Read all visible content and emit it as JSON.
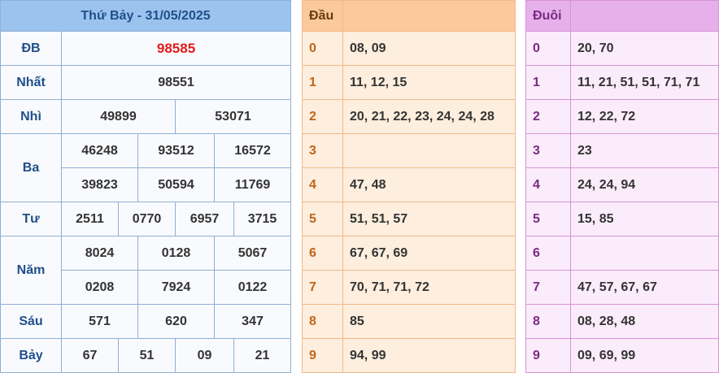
{
  "results": {
    "title": "Thứ Bảy - 31/05/2025",
    "prizes": [
      {
        "label": "ĐB",
        "values": [
          "98585"
        ]
      },
      {
        "label": "Nhất",
        "values": [
          "98551"
        ]
      },
      {
        "label": "Nhì",
        "values": [
          "49899",
          "53071"
        ]
      },
      {
        "label": "Ba",
        "values": [
          "46248",
          "93512",
          "16572",
          "39823",
          "50594",
          "11769"
        ]
      },
      {
        "label": "Tư",
        "values": [
          "2511",
          "0770",
          "6957",
          "3715"
        ]
      },
      {
        "label": "Năm",
        "values": [
          "8024",
          "0128",
          "5067",
          "0208",
          "7924",
          "0122"
        ]
      },
      {
        "label": "Sáu",
        "values": [
          "571",
          "620",
          "347"
        ]
      },
      {
        "label": "Bảy",
        "values": [
          "67",
          "51",
          "09",
          "21"
        ]
      }
    ]
  },
  "dau": {
    "header": "Đầu",
    "rows": [
      {
        "key": "0",
        "value": "08, 09"
      },
      {
        "key": "1",
        "value": "11, 12, 15"
      },
      {
        "key": "2",
        "value": "20, 21, 22, 23, 24, 24, 28"
      },
      {
        "key": "3",
        "value": ""
      },
      {
        "key": "4",
        "value": "47, 48"
      },
      {
        "key": "5",
        "value": "51, 51, 57"
      },
      {
        "key": "6",
        "value": "67, 67, 69"
      },
      {
        "key": "7",
        "value": "70, 71, 71, 72"
      },
      {
        "key": "8",
        "value": "85"
      },
      {
        "key": "9",
        "value": "94, 99"
      }
    ]
  },
  "duoi": {
    "header": "Đuôi",
    "rows": [
      {
        "key": "0",
        "value": "20, 70"
      },
      {
        "key": "1",
        "value": "11, 21, 51, 51, 71, 71"
      },
      {
        "key": "2",
        "value": "12, 22, 72"
      },
      {
        "key": "3",
        "value": "23"
      },
      {
        "key": "4",
        "value": "24, 24, 94"
      },
      {
        "key": "5",
        "value": "15, 85"
      },
      {
        "key": "6",
        "value": ""
      },
      {
        "key": "7",
        "value": "47, 57, 67, 67"
      },
      {
        "key": "8",
        "value": "08, 28, 48"
      },
      {
        "key": "9",
        "value": "09, 69, 99"
      }
    ]
  },
  "colors": {
    "special_prize": "#e31b1b",
    "results_header": "#9cc3ee",
    "dau_header": "#fbc99b",
    "duoi_header": "#e6b1ea"
  }
}
